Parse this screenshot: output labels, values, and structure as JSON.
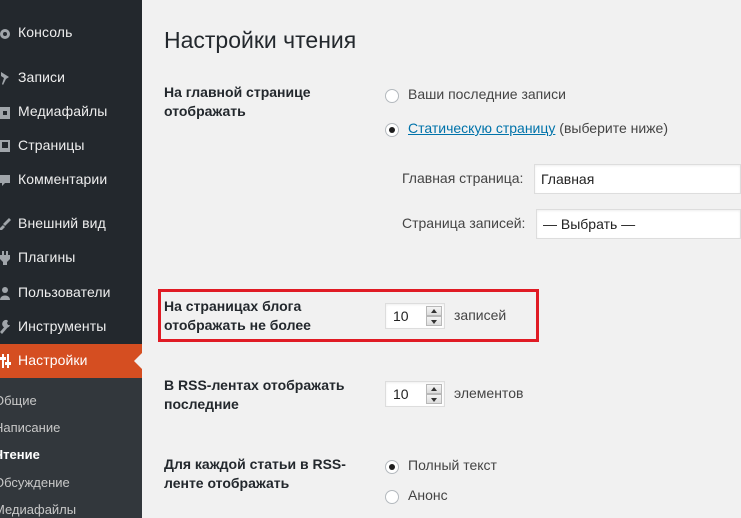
{
  "sidebar": {
    "items": [
      {
        "label": "Консоль",
        "icon": "gauge-icon"
      },
      {
        "label": "Записи",
        "icon": "pin-icon"
      },
      {
        "label": "Медиафайлы",
        "icon": "media-icon"
      },
      {
        "label": "Страницы",
        "icon": "page-icon"
      },
      {
        "label": "Комментарии",
        "icon": "comment-icon"
      },
      {
        "label": "Внешний вид",
        "icon": "brush-icon"
      },
      {
        "label": "Плагины",
        "icon": "plug-icon"
      },
      {
        "label": "Пользователи",
        "icon": "user-icon"
      },
      {
        "label": "Инструменты",
        "icon": "wrench-icon"
      },
      {
        "label": "Настройки",
        "icon": "settings-icon",
        "active": true
      }
    ],
    "submenu": [
      {
        "label": "Общие"
      },
      {
        "label": "Написание"
      },
      {
        "label": "Чтение",
        "current": true
      },
      {
        "label": "Обсуждение"
      },
      {
        "label": "Медиафайлы"
      }
    ],
    "colors": {
      "background": "#23282d",
      "active": "#d54e21",
      "submenu_background": "#32373c"
    }
  },
  "page": {
    "title": "Настройки чтения",
    "front_page_display": {
      "label": "На главной странице отображать",
      "option_latest": "Ваши последние записи",
      "option_static_link": "Статическую страницу",
      "option_static_suffix": "(выберите ниже)",
      "selected": "static",
      "front_page_label": "Главная страница:",
      "front_page_value": "Главная",
      "posts_page_label": "Страница записей:",
      "posts_page_value": "— Выбрать —"
    },
    "posts_per_page": {
      "label": "На страницах блога отображать не более",
      "value": "10",
      "unit": "записей",
      "highlighted": true,
      "highlight_color": "#e01b24"
    },
    "rss_posts": {
      "label": "В RSS-лентах отображать последние",
      "value": "10",
      "unit": "элементов"
    },
    "rss_content": {
      "label": "Для каждой статьи в RSS-ленте отображать",
      "option_full": "Полный текст",
      "option_summary": "Анонс",
      "selected": "full"
    }
  }
}
